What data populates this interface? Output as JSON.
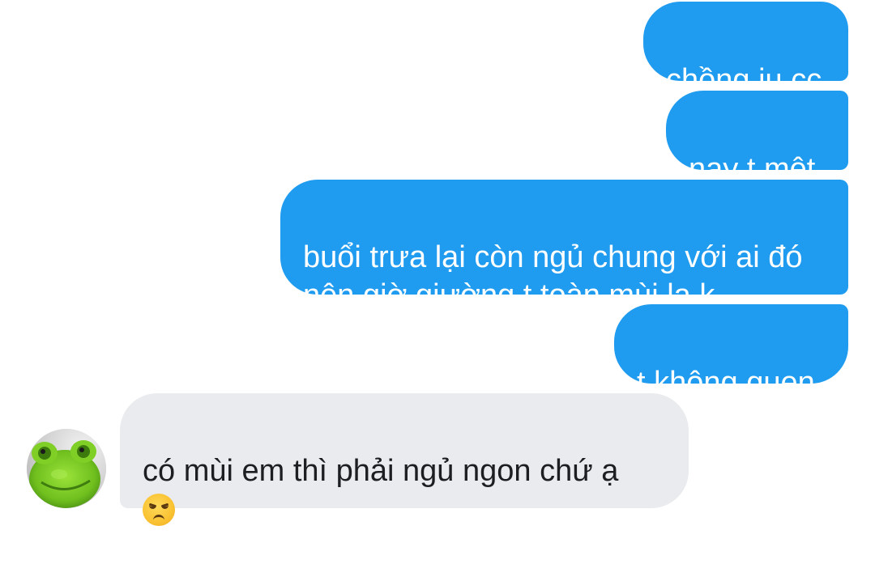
{
  "conversation": {
    "messages": [
      {
        "direction": "outgoing",
        "text": "chồng iu cc"
      },
      {
        "direction": "outgoing",
        "text": "nay t mệt"
      },
      {
        "direction": "outgoing",
        "text": "buổi trưa lại còn ngủ chung với ai đó\nnên giờ giường t toàn mùi lạ k"
      },
      {
        "direction": "outgoing",
        "text": "t không quen"
      },
      {
        "direction": "incoming",
        "text": "có mùi em thì phải ngủ ngon chứ ạ",
        "emoji": "disappointed-face"
      }
    ]
  },
  "contact": {
    "avatar_icon": "green-frog-plush-avatar"
  },
  "colors": {
    "outgoing_bubble": "#1f9bf0",
    "outgoing_text": "#ffffff",
    "incoming_bubble": "#e9ebee",
    "incoming_text": "#1c1e21",
    "background": "#ffffff"
  }
}
